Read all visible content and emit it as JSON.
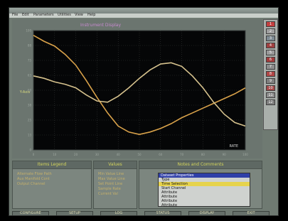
{
  "window": {
    "title": ""
  },
  "menubar": {
    "items": [
      "File",
      "Edit",
      "Parameters",
      "Utilities",
      "View",
      "Help"
    ]
  },
  "chart_data": {
    "type": "line",
    "title": "Instrument Display",
    "xlabel": "",
    "ylabel": "Y-Axis",
    "grid": true,
    "x": [
      0,
      5,
      10,
      15,
      20,
      25,
      30,
      35,
      40,
      45,
      50,
      55,
      60,
      65,
      70,
      75,
      80,
      85,
      90,
      95,
      100
    ],
    "xlim": [
      0,
      100
    ],
    "ylim": [
      0,
      100
    ],
    "series": [
      {
        "color": "#d9a24a",
        "values": [
          96,
          91,
          87,
          80,
          71,
          58,
          44,
          31,
          20,
          15,
          13,
          15,
          18,
          22,
          27,
          31,
          35,
          39,
          43,
          47,
          52
        ]
      },
      {
        "color": "#d6c28d",
        "values": [
          62,
          60,
          57,
          55,
          52,
          46,
          41,
          40,
          45,
          52,
          60,
          67,
          72,
          73,
          70,
          62,
          52,
          40,
          30,
          23,
          20
        ]
      }
    ],
    "annotations": [
      "RATE"
    ]
  },
  "toolbar": {
    "buttons": [
      "1",
      "2",
      "3",
      "4",
      "5",
      "6",
      "7",
      "8",
      "9",
      "10",
      "11",
      "12"
    ]
  },
  "panels": {
    "legend": {
      "title": "Items Legend",
      "items": [
        "Alternate Flow Path",
        "Aux Manifold Cont",
        "Output Channel"
      ]
    },
    "values": {
      "title": "Values",
      "items": [
        "Min Value Line",
        "Max Value Line",
        "Set Point Line",
        "Sample Rate",
        "Current Val"
      ]
    },
    "table": {
      "title": "Notes and Comments",
      "dialog_title": "Dataset Properties",
      "dialog_rows": [
        "Type",
        "Time Selection",
        "Start Channel",
        "Attribute",
        "Attribute",
        "Attribute",
        "Attribute"
      ]
    }
  },
  "bottom_buttons": [
    "CONFIGURE",
    "SETUP",
    "LOG",
    "STATUS",
    "DISPLAY",
    "EXIT"
  ]
}
